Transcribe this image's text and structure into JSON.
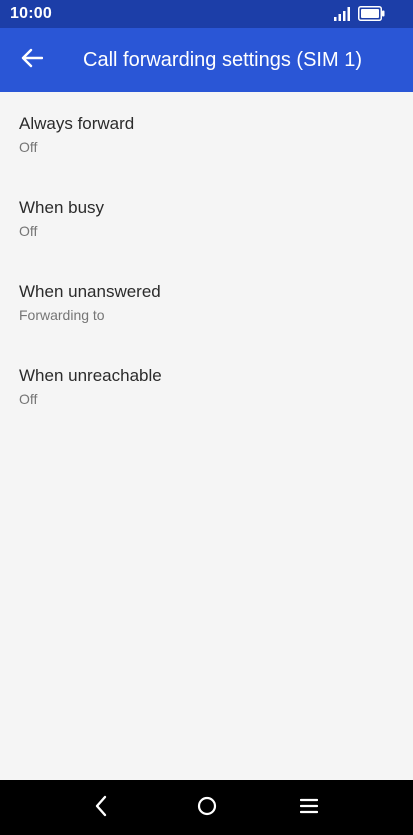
{
  "status_bar": {
    "time": "10:00",
    "signal_icon": "signal-bars-icon",
    "battery_icon": "battery-icon"
  },
  "toolbar": {
    "back_icon": "arrow-back-icon",
    "title": "Call forwarding settings (SIM 1)"
  },
  "settings": [
    {
      "title": "Always forward",
      "summary": "Off"
    },
    {
      "title": "When busy",
      "summary": "Off"
    },
    {
      "title": "When unanswered",
      "summary": "Forwarding to"
    },
    {
      "title": "When unreachable",
      "summary": "Off"
    }
  ],
  "nav_bar": {
    "back_icon": "nav-back-icon",
    "home_icon": "nav-home-icon",
    "recents_icon": "nav-menu-icon"
  },
  "colors": {
    "status_bar": "#1c3ea8",
    "toolbar": "#2a56d6",
    "background": "#f5f5f5",
    "title_text": "#2b2b2b",
    "summary_text": "#757575"
  }
}
